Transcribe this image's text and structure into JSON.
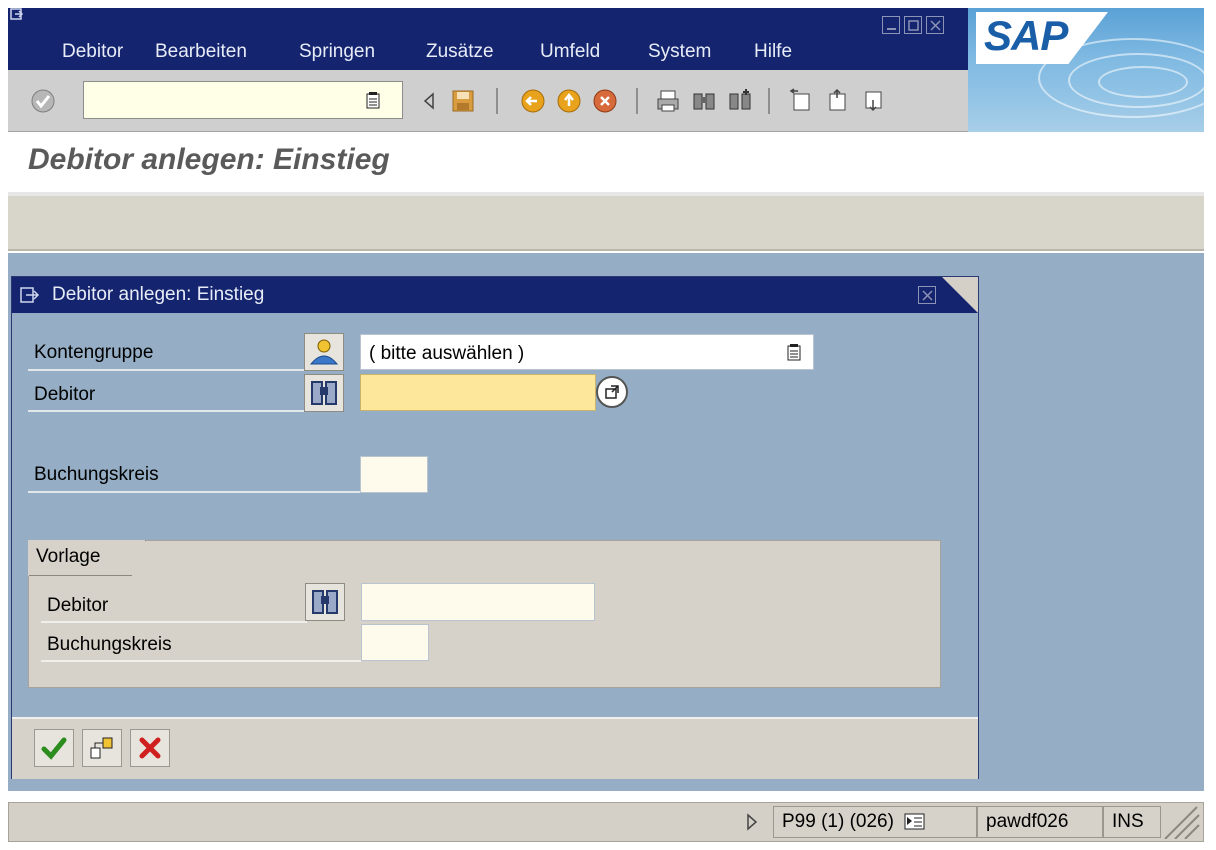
{
  "menu": {
    "items": [
      {
        "label": "Debitor"
      },
      {
        "label": "Bearbeiten"
      },
      {
        "label": "Springen"
      },
      {
        "label": "Zusätze"
      },
      {
        "label": "Umfeld"
      },
      {
        "label": "System"
      },
      {
        "label": "Hilfe"
      }
    ]
  },
  "brand": {
    "logo_text": "SAP"
  },
  "toolbar": {
    "command_value": ""
  },
  "page": {
    "title": "Debitor anlegen: Einstieg"
  },
  "dialog": {
    "title": "Debitor anlegen: Einstieg",
    "kontengruppe_label": "Kontengruppe",
    "kontengruppe_value": "( bitte auswählen )",
    "debitor_label": "Debitor",
    "debitor_value": "",
    "buchungskreis_label": "Buchungskreis",
    "buchungskreis_value": "",
    "vorlage": {
      "title": "Vorlage",
      "debitor_label": "Debitor",
      "debitor_value": "",
      "buchungskreis_label": "Buchungskreis",
      "buchungskreis_value": ""
    }
  },
  "statusbar": {
    "system": "P99 (1) (026)",
    "server": "pawdf026",
    "mode": "INS"
  },
  "colors": {
    "titlebar": "#14246e",
    "workarea": "#95aec5",
    "toolbar": "#cfcfcf",
    "input_required": "#fde79a"
  }
}
